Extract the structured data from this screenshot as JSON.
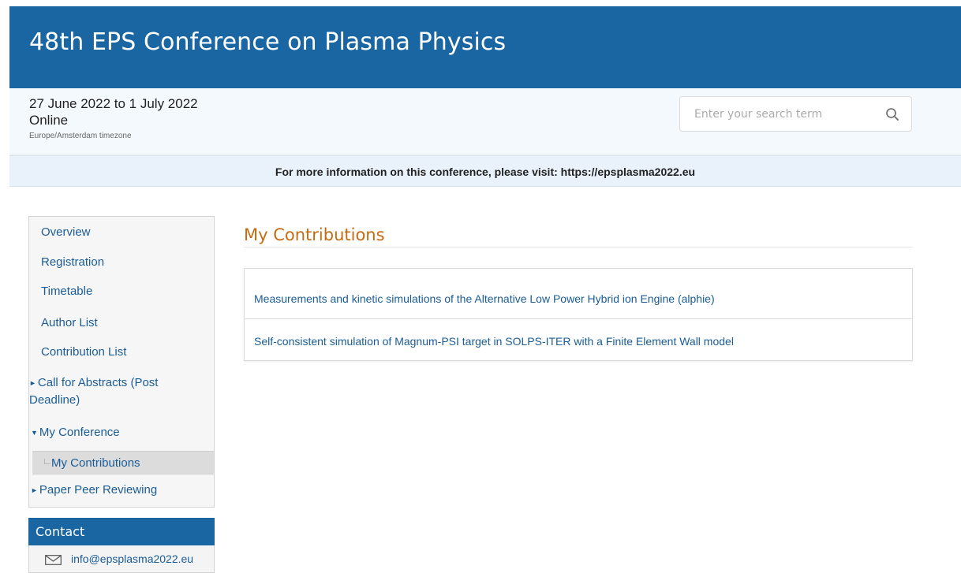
{
  "header": {
    "title": "48th EPS Conference on Plasma Physics"
  },
  "event": {
    "dates": "27 June 2022 to 1 July 2022",
    "location": "Online",
    "timezone": "Europe/Amsterdam timezone"
  },
  "search": {
    "placeholder": "Enter your search term",
    "icon": "search-icon"
  },
  "banner": {
    "text": "For more information on this conference, please visit: https://epsplasma2022.eu"
  },
  "sidebar": {
    "items": [
      {
        "label": "Overview"
      },
      {
        "label": "Registration"
      },
      {
        "label": "Timetable"
      },
      {
        "label": "Author List"
      },
      {
        "label": "Contribution List"
      },
      {
        "label": "Call for Abstracts (Post",
        "label2": "Deadline)"
      },
      {
        "label": "My Conference"
      },
      {
        "label": "My Contributions"
      },
      {
        "label": "Paper Peer Reviewing"
      }
    ]
  },
  "contact": {
    "title": "Contact",
    "email": "info@epsplasma2022.eu"
  },
  "main": {
    "title": "My Contributions",
    "contributions": [
      {
        "title": "Measurements and kinetic simulations of the Alternative Low Power Hybrid ion Engine (alphie)"
      },
      {
        "title": "Self-consistent simulation of Magnum-PSI target in SOLPS-ITER with a Finite Element Wall model"
      }
    ]
  },
  "colors": {
    "header_bg": "#1a66a3",
    "link": "#1a5c96",
    "page_title": "#c56b12",
    "banner_bg": "#e9f2fb",
    "subheader_bg": "#f4f9fd"
  }
}
